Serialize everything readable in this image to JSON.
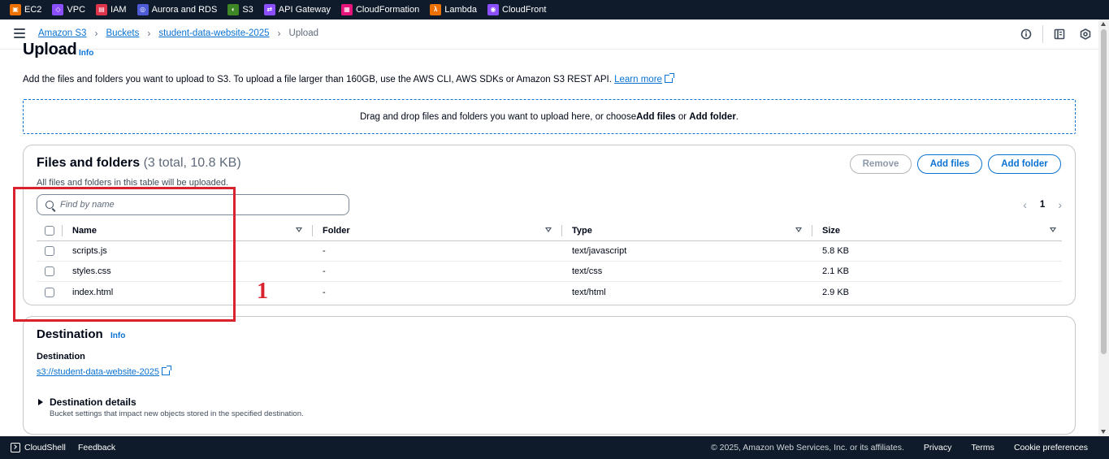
{
  "services": [
    {
      "label": "EC2",
      "icon": "ec2-icon",
      "color": "#ed7100"
    },
    {
      "label": "VPC",
      "icon": "vpc-icon",
      "color": "#8c4fff"
    },
    {
      "label": "IAM",
      "icon": "iam-icon",
      "color": "#dd344c"
    },
    {
      "label": "Aurora and RDS",
      "icon": "rds-icon",
      "color": "#4d5bd9"
    },
    {
      "label": "S3",
      "icon": "s3-icon",
      "color": "#3f8624"
    },
    {
      "label": "API Gateway",
      "icon": "api-gateway-icon",
      "color": "#8c4fff"
    },
    {
      "label": "CloudFormation",
      "icon": "cloudformation-icon",
      "color": "#e7157b"
    },
    {
      "label": "Lambda",
      "icon": "lambda-icon",
      "color": "#ed7100"
    },
    {
      "label": "CloudFront",
      "icon": "cloudfront-icon",
      "color": "#8c4fff"
    }
  ],
  "breadcrumb": {
    "items": [
      "Amazon S3",
      "Buckets",
      "student-data-website-2025"
    ],
    "current": "Upload",
    "separator": "›"
  },
  "page": {
    "title": "Upload",
    "info": "Info",
    "description": "Add the files and folders you want to upload to S3. To upload a file larger than 160GB, use the AWS CLI, AWS SDKs or Amazon S3 REST API.",
    "learn_more": "Learn more",
    "dropzone_prefix": "Drag and drop files and folders you want to upload here, or choose ",
    "dropzone_add_files": "Add files",
    "dropzone_or": " or ",
    "dropzone_add_folder": "Add folder",
    "dropzone_suffix": "."
  },
  "files_panel": {
    "title": "Files and folders",
    "count": "(3 total, 10.8 KB)",
    "subtitle": "All files and folders in this table will be uploaded.",
    "remove_label": "Remove",
    "add_files_label": "Add files",
    "add_folder_label": "Add folder",
    "search_placeholder": "Find by name",
    "page_number": "1",
    "prev": "‹",
    "next": "›",
    "columns": [
      "Name",
      "Folder",
      "Type",
      "Size"
    ],
    "rows": [
      {
        "name": "scripts.js",
        "folder": "-",
        "type": "text/javascript",
        "size": "5.8 KB"
      },
      {
        "name": "styles.css",
        "folder": "-",
        "type": "text/css",
        "size": "2.1 KB"
      },
      {
        "name": "index.html",
        "folder": "-",
        "type": "text/html",
        "size": "2.9 KB"
      }
    ]
  },
  "annotation": {
    "label": "1",
    "color": "#d8232f"
  },
  "destination": {
    "title": "Destination",
    "info": "Info",
    "label": "Destination",
    "bucket_link": "s3://student-data-website-2025",
    "details_title": "Destination details",
    "details_sub": "Bucket settings that impact new objects stored in the specified destination."
  },
  "footer": {
    "cloudshell": "CloudShell",
    "feedback": "Feedback",
    "copyright": "© 2025, Amazon Web Services, Inc. or its affiliates.",
    "privacy": "Privacy",
    "terms": "Terms",
    "cookies": "Cookie preferences"
  }
}
